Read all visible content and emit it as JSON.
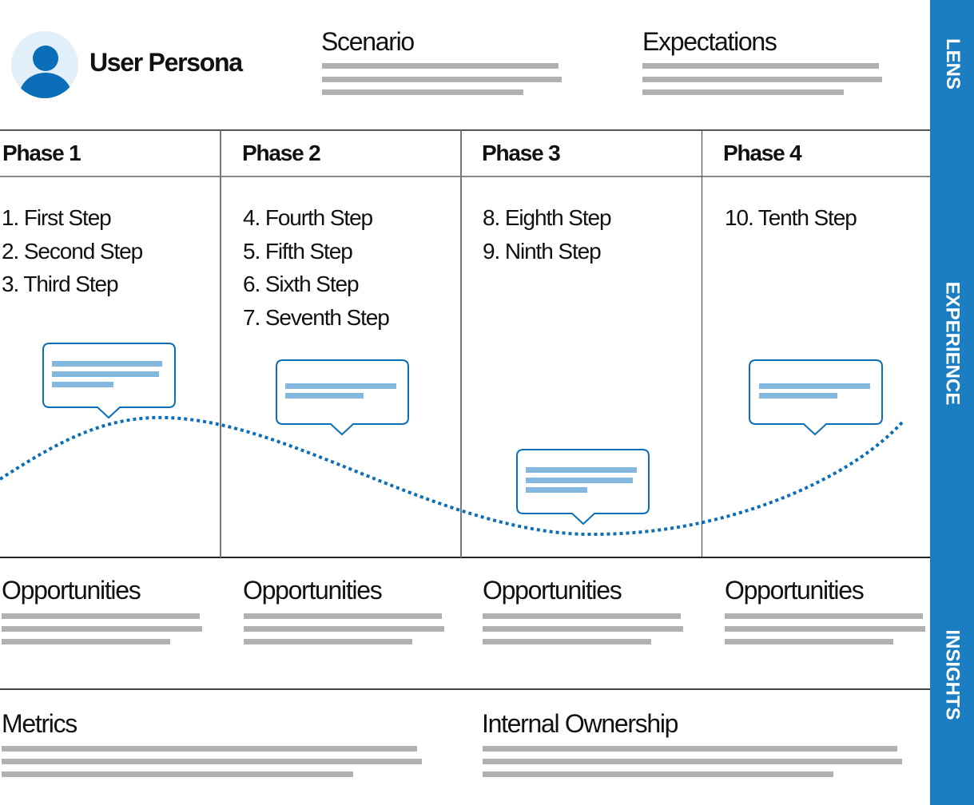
{
  "band": {
    "color": "#1b7dc2",
    "labels": [
      "LENS",
      "EXPERIENCE",
      "INSIGHTS"
    ]
  },
  "lens": {
    "persona": {
      "title": "User Persona",
      "icon": "user-avatar-icon"
    },
    "scenario": {
      "title": "Scenario",
      "placeholder_lines": 3
    },
    "expectations": {
      "title": "Expectations",
      "placeholder_lines": 3
    }
  },
  "experience": {
    "phases": [
      {
        "title": "Phase 1",
        "steps": [
          "1. First Step",
          "2. Second Step",
          "3. Third Step"
        ],
        "bubble_lines": 3
      },
      {
        "title": "Phase 2",
        "steps": [
          "4. Fourth Step",
          "5. Fifth Step",
          "6. Sixth Step",
          "7. Seventh Step"
        ],
        "bubble_lines": 2
      },
      {
        "title": "Phase 3",
        "steps": [
          "8. Eighth Step",
          "9. Ninth Step"
        ],
        "bubble_lines": 3
      },
      {
        "title": "Phase 4",
        "steps": [
          "10. Tenth Step"
        ],
        "bubble_lines": 2
      }
    ],
    "emotion_curve": {
      "style": "dotted",
      "color": "#0a6fb8",
      "trend": [
        "rising",
        "peak",
        "falling",
        "trough",
        "rising"
      ]
    }
  },
  "insights": {
    "opportunities": [
      {
        "title": "Opportunities",
        "placeholder_lines": 3
      },
      {
        "title": "Opportunities",
        "placeholder_lines": 3
      },
      {
        "title": "Opportunities",
        "placeholder_lines": 3
      },
      {
        "title": "Opportunities",
        "placeholder_lines": 3
      }
    ],
    "metrics": {
      "title": "Metrics",
      "placeholder_lines": 3
    },
    "ownership": {
      "title": "Internal Ownership",
      "placeholder_lines": 3
    }
  },
  "colors": {
    "accent": "#0a6fb8",
    "bubble_text_placeholder": "#85b8de",
    "placeholder_gray": "#b1b1b1",
    "avatar_bg": "#e2eef8"
  }
}
